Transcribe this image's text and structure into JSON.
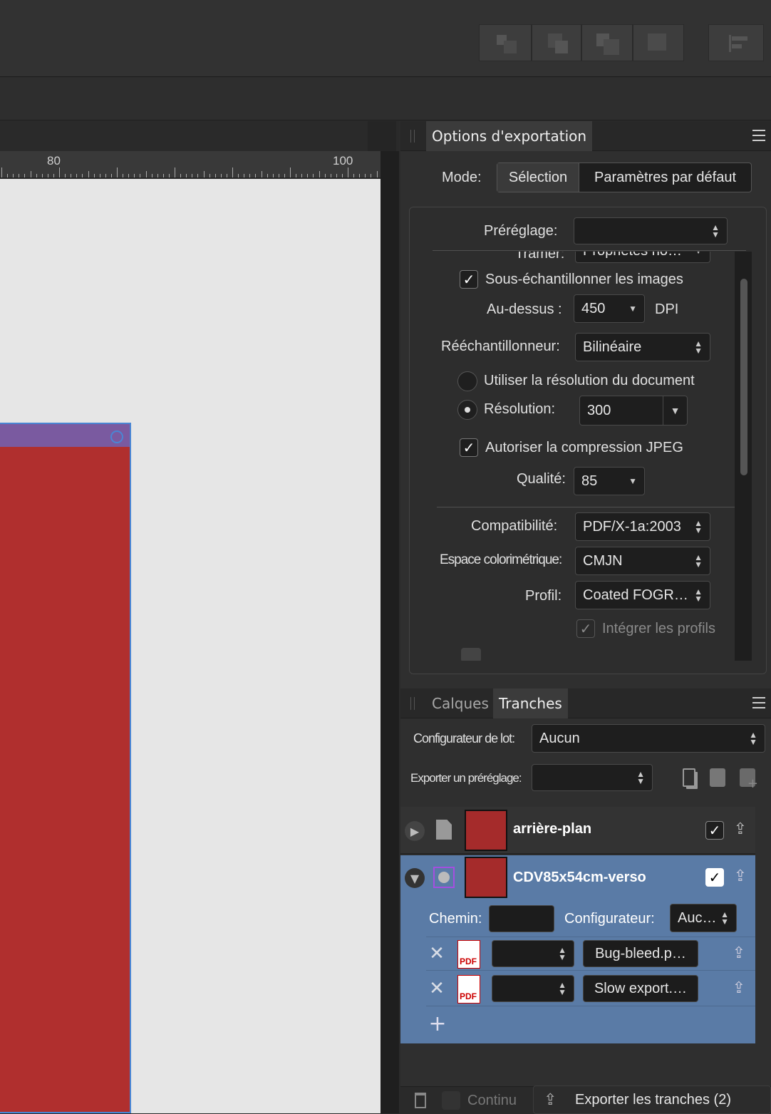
{
  "toolbar": {
    "buttons": [
      "arrange-back-icon",
      "arrange-backward-icon",
      "arrange-forward-icon",
      "arrange-front-icon"
    ],
    "align_icon": "align-left-icon"
  },
  "ruler": {
    "labels": [
      "80",
      "100"
    ]
  },
  "export_panel": {
    "tab": "Options d'exportation",
    "mode_label": "Mode:",
    "mode_options": [
      "Sélection",
      "Paramètres par défaut"
    ],
    "preset_label": "Préréglage:",
    "preset_value": "",
    "tramer_label": "Tramer:",
    "tramer_value": "Propriétés no…",
    "downsample_label": "Sous-échantillonner les images",
    "above_label": "Au-dessus :",
    "above_value": "450",
    "dpi_label": "DPI",
    "resampler_label": "Rééchantillonneur:",
    "resampler_value": "Bilinéaire",
    "use_doc_res_label": "Utiliser la résolution du document",
    "resolution_label": "Résolution:",
    "resolution_value": "300",
    "jpeg_label": "Autoriser la compression JPEG",
    "quality_label": "Qualité:",
    "quality_value": "85",
    "compat_label": "Compatibilité:",
    "compat_value": "PDF/X-1a:2003",
    "colorspace_label": "Espace colorimétrique:",
    "colorspace_value": "CMJN",
    "profile_label": "Profil:",
    "profile_value": "Coated FOGR…",
    "embed_label": "Intégrer les profils"
  },
  "slices_panel": {
    "tabs": [
      "Calques",
      "Tranches"
    ],
    "batch_label": "Configurateur de lot:",
    "batch_value": "Aucun",
    "export_preset_label": "Exporter un préréglage:",
    "export_preset_value": "",
    "layers": [
      {
        "name": "arrière-plan"
      },
      {
        "name": "CDV85x54cm-verso"
      }
    ],
    "path_label": "Chemin:",
    "path_value": "",
    "configurator_label": "Configurateur:",
    "configurator_value": "Auc…",
    "outputs": [
      {
        "file": "Bug-bleed.p…",
        "format": "PDF"
      },
      {
        "file": "Slow export.…",
        "format": "PDF"
      }
    ],
    "continuous_label": "Continu",
    "export_slices_label": "Exporter les tranches (2)"
  }
}
